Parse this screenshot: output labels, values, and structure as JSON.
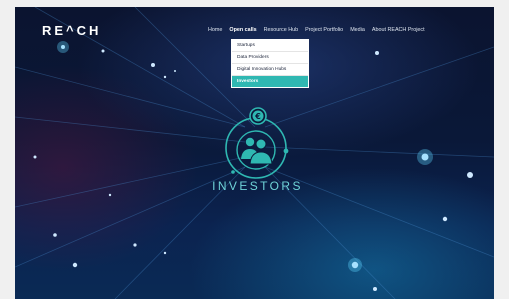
{
  "brand": {
    "logo_text": "RE^CH"
  },
  "nav": {
    "items": [
      {
        "label": "Home"
      },
      {
        "label": "Open calls"
      },
      {
        "label": "Resource Hub"
      },
      {
        "label": "Project Portfolio"
      },
      {
        "label": "Media"
      },
      {
        "label": "About REACH Project"
      }
    ],
    "active": "Open calls"
  },
  "dropdown": {
    "items": [
      {
        "label": "Startups"
      },
      {
        "label": "Data Providers"
      },
      {
        "label": "Digital Innovation Hubs"
      },
      {
        "label": "Investors"
      }
    ],
    "selected": "Investors"
  },
  "hero": {
    "title": "INVESTORS",
    "icon": "investors-icon",
    "accent_color": "#2fb8b2"
  }
}
